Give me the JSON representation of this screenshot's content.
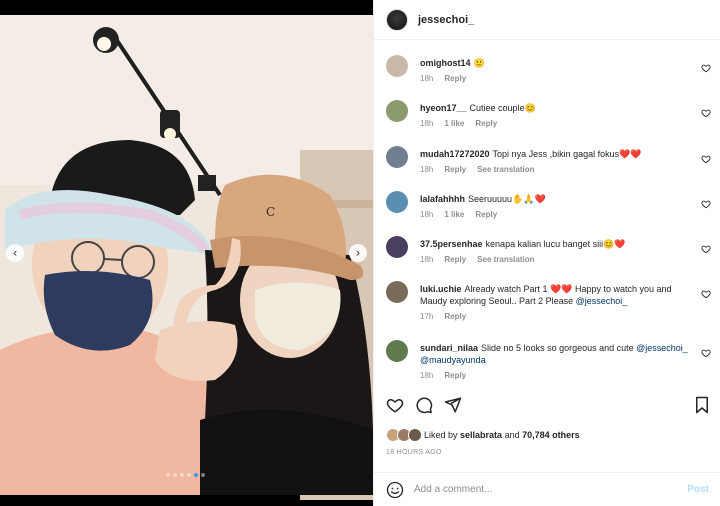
{
  "post": {
    "author": "jessechoi_",
    "carousel": {
      "total": 6,
      "active_index": 4
    }
  },
  "comments": [
    {
      "user": "omighost14",
      "text": "🙂",
      "time": "18h",
      "actions": [
        "Reply"
      ]
    },
    {
      "user": "hyeon17__",
      "text": "Cutiee couple😊",
      "time": "18h",
      "actions": [
        "1 like",
        "Reply"
      ]
    },
    {
      "user": "mudah17272020",
      "text": "Topi nya Jess ,bikin gagal fokus❤️❤️",
      "time": "18h",
      "actions": [
        "Reply",
        "See translation"
      ]
    },
    {
      "user": "lalafahhhh",
      "text": "Seeruuuuu✋🙏❤️",
      "time": "18h",
      "actions": [
        "1 like",
        "Reply"
      ]
    },
    {
      "user": "37.5persenhae",
      "text": "kenapa kalian lucu banget siii😊❤️",
      "time": "18h",
      "actions": [
        "Reply",
        "See translation"
      ]
    },
    {
      "user": "luki.uchie",
      "text": "Already watch Part 1 ❤️❤️ Happy to watch you and Maudy exploring Seoul.. Part 2 Please ",
      "mention": "@jessechoi_",
      "time": "17h",
      "actions": [
        "Reply"
      ]
    },
    {
      "user": "sundari_nilaa",
      "text": "Slide no 5 looks so gorgeous and cute ",
      "mention": "@jessechoi_ @maudyayunda",
      "time": "18h",
      "actions": [
        "Reply"
      ]
    }
  ],
  "likes": {
    "prefix": "Liked by ",
    "user": "sellabrata",
    "middle": " and ",
    "count": "70,784 others"
  },
  "timestamp": "18 HOURS AGO",
  "add_comment": {
    "placeholder": "Add a comment...",
    "post_label": "Post"
  },
  "nav": {
    "prev": "‹",
    "next": "›"
  },
  "icons": [
    "heart-icon",
    "comment-icon",
    "share-icon",
    "bookmark-icon",
    "emoji-icon"
  ],
  "colors": {
    "mention": "#00376b",
    "post_disabled": "#b2dffc",
    "meta": "#8e8e8e",
    "dot_active": "#3897f0"
  }
}
